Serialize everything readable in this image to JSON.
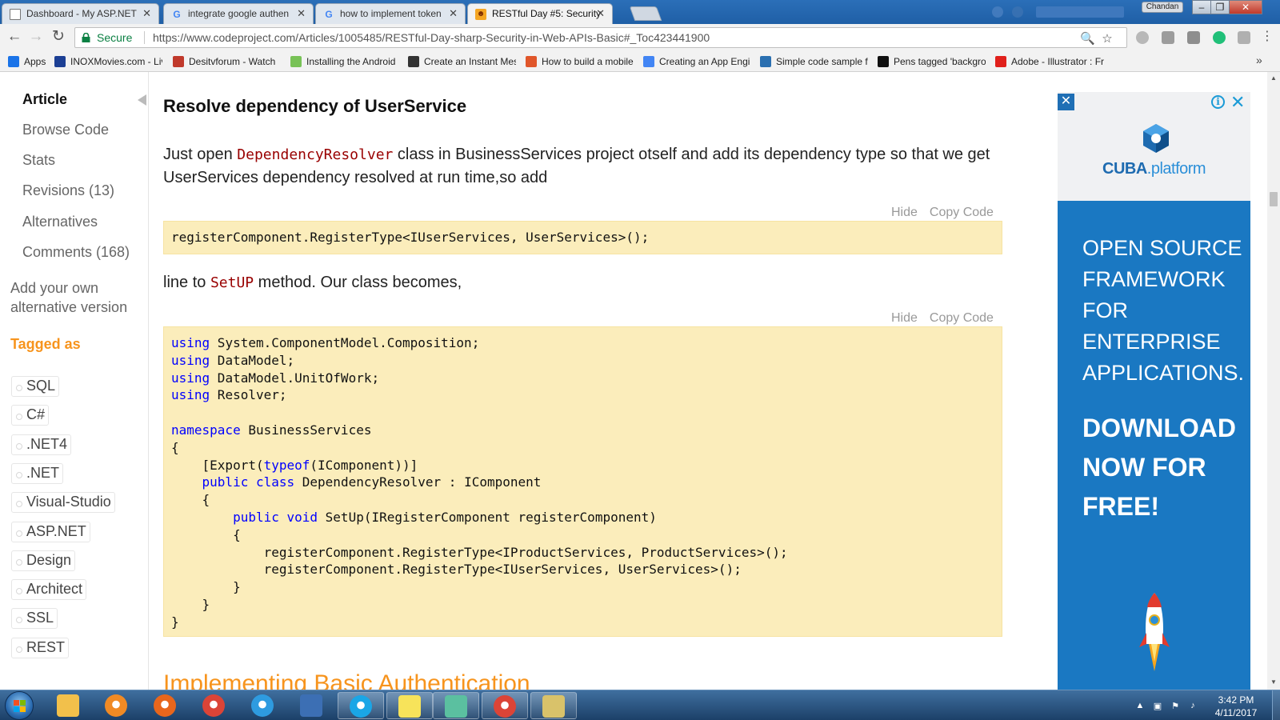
{
  "browser": {
    "tabs": [
      {
        "title": "Dashboard - My ASP.NET",
        "icon": "page-icon"
      },
      {
        "title": "integrate google authen",
        "icon": "google-icon"
      },
      {
        "title": "how to implement token",
        "icon": "google-icon"
      },
      {
        "title": "RESTful Day #5: Security",
        "icon": "codeproject-icon",
        "active": true
      }
    ],
    "close_glyph": "✕",
    "user_label": "Chandan",
    "window_buttons": {
      "minimize": "–",
      "maximize": "❐",
      "close": "✕"
    },
    "address": {
      "secure_label": "Secure",
      "url": "https://www.codeproject.com/Articles/1005485/RESTful-Day-sharp-Security-in-Web-APIs-Basic#_Toc423441900"
    },
    "bookmarks": [
      {
        "label": "Apps",
        "color": "#1a73e8"
      },
      {
        "label": "INOXMovies.com - Liv",
        "color": "#1c3f94"
      },
      {
        "label": "Desitvforum - Watch",
        "color": "#c0392b"
      },
      {
        "label": "Installing the Android",
        "color": "#78c257"
      },
      {
        "label": "Create an Instant Mes",
        "color": "#333333"
      },
      {
        "label": "How to build a mobile",
        "color": "#e0562a"
      },
      {
        "label": "Creating an App Engi",
        "color": "#4285f4"
      },
      {
        "label": "Simple code sample fo",
        "color": "#2a6fb0"
      },
      {
        "label": "Pens tagged 'backgro",
        "color": "#111111"
      },
      {
        "label": "Adobe - Illustrator : Fr",
        "color": "#e0201b"
      }
    ],
    "bookmarks_more": "»"
  },
  "sidebar": {
    "links": [
      {
        "label": "Article",
        "active": true
      },
      {
        "label": "Browse Code"
      },
      {
        "label": "Stats"
      },
      {
        "label": "Revisions (13)"
      },
      {
        "label": "Alternatives"
      },
      {
        "label": "Comments (168)"
      }
    ],
    "add_alternative": "Add your own alternative version",
    "tagged_as": "Tagged as",
    "tags": [
      "SQL",
      "C#",
      ".NET4",
      ".NET",
      "Visual-Studio",
      "ASP.NET",
      "Design",
      "Architect",
      "SSL",
      "REST"
    ]
  },
  "article": {
    "section_title": "Resolve dependency of UserService",
    "para1_before": "Just open ",
    "para1_code": "DependencyResolver",
    "para1_after": " class in BusinessServices project otself and add its dependency type so that we get UserServices dependency resolved at run time,so add",
    "hide_label": "Hide",
    "copy_label": "Copy Code",
    "code1": "registerComponent.RegisterType<IUserServices, UserServices>();",
    "para2_before": "line to ",
    "para2_code": "SetUP",
    "para2_after": " method. Our class becomes,",
    "code2_lines": [
      [
        {
          "k": "using"
        },
        {
          "t": " System.ComponentModel.Composition;"
        }
      ],
      [
        {
          "k": "using"
        },
        {
          "t": " DataModel;"
        }
      ],
      [
        {
          "k": "using"
        },
        {
          "t": " DataModel.UnitOfWork;"
        }
      ],
      [
        {
          "k": "using"
        },
        {
          "t": " Resolver;"
        }
      ],
      [],
      [
        {
          "k": "namespace"
        },
        {
          "t": " BusinessServices"
        }
      ],
      [
        {
          "t": "{"
        }
      ],
      [
        {
          "t": "    [Export("
        },
        {
          "k": "typeof"
        },
        {
          "t": "(IComponent))]"
        }
      ],
      [
        {
          "t": "    "
        },
        {
          "k": "public"
        },
        {
          "t": " "
        },
        {
          "k": "class"
        },
        {
          "t": " DependencyResolver : IComponent"
        }
      ],
      [
        {
          "t": "    {"
        }
      ],
      [
        {
          "t": "        "
        },
        {
          "k": "public"
        },
        {
          "t": " "
        },
        {
          "k": "void"
        },
        {
          "t": " SetUp(IRegisterComponent registerComponent)"
        }
      ],
      [
        {
          "t": "        {"
        }
      ],
      [
        {
          "t": "            registerComponent.RegisterType<IProductServices, ProductServices>();"
        }
      ],
      [
        {
          "t": "            registerComponent.RegisterType<IUserServices, UserServices>();"
        }
      ],
      [
        {
          "t": "        }"
        }
      ],
      [
        {
          "t": "    }"
        }
      ],
      [
        {
          "t": "}"
        }
      ]
    ],
    "next_heading": "Implementing Basic Authentication"
  },
  "ad": {
    "close_left": "✕",
    "info": "i",
    "close_right": "✕",
    "brand": "CUBA",
    "brand_suffix": ".platform",
    "headline": "OPEN SOURCE FRAMEWORK FOR ENTERPRISE APPLICATIONS.",
    "cta": "DOWNLOAD NOW FOR FREE!"
  },
  "taskbar": {
    "apps": [
      {
        "name": "windows-explorer-icon",
        "color": "#f2c04b"
      },
      {
        "name": "media-player-icon",
        "color": "#f08a24"
      },
      {
        "name": "firefox-icon",
        "color": "#e8661c"
      },
      {
        "name": "chrome-icon",
        "color": "#db4437"
      },
      {
        "name": "internet-explorer-icon",
        "color": "#2e9be0"
      },
      {
        "name": "remote-desktop-icon",
        "color": "#3c6fb4"
      },
      {
        "name": "skype-icon",
        "color": "#1aa6e6"
      },
      {
        "name": "sticky-notes-icon",
        "color": "#f7e35a"
      },
      {
        "name": "visual-studio-icon",
        "color": "#5bc0a0"
      },
      {
        "name": "chrome-icon",
        "color": "#db4437"
      },
      {
        "name": "snipping-tool-icon",
        "color": "#d9c26a"
      }
    ],
    "time": "3:42 PM",
    "date": "4/11/2017"
  }
}
